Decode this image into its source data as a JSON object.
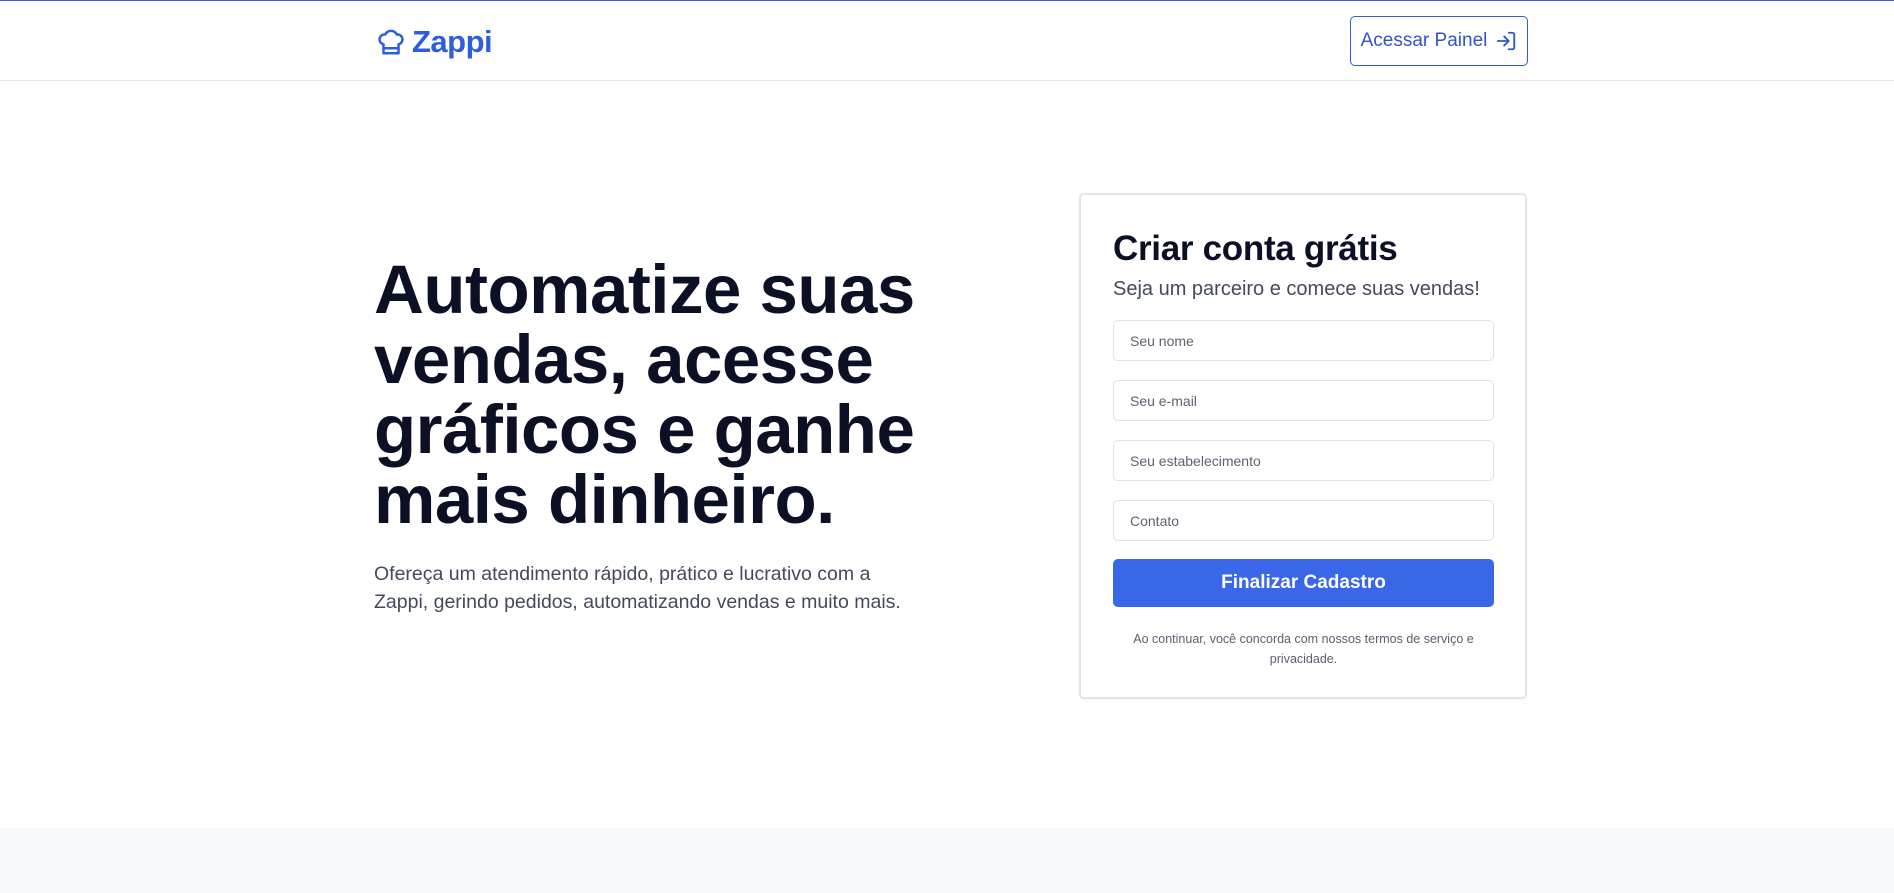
{
  "header": {
    "brand": "Zappi",
    "logo_icon": "chef-hat-icon",
    "panel_button_label": "Acessar Painel",
    "panel_button_icon": "log-in-icon"
  },
  "hero": {
    "title": "Automatize suas vendas, acesse gráficos e ganhe mais dinheiro.",
    "subtitle": "Ofereça um atendimento rápido, prático e lucrativo com a Zappi, gerindo pedidos, automatizando vendas e muito mais."
  },
  "signup": {
    "title": "Criar conta grátis",
    "subtitle": "Seja um parceiro e comece suas vendas!",
    "fields": {
      "name": {
        "placeholder": "Seu nome",
        "value": ""
      },
      "email": {
        "placeholder": "Seu e-mail",
        "value": ""
      },
      "business": {
        "placeholder": "Seu estabelecimento",
        "value": ""
      },
      "contact": {
        "placeholder": "Contato",
        "value": ""
      }
    },
    "submit_label": "Finalizar Cadastro",
    "terms": "Ao continuar, você concorda com nossos termos de serviço e privacidade."
  },
  "colors": {
    "accent": "#3a67e8",
    "brand": "#2f5de0",
    "heading": "#0c1024",
    "muted": "#434a5c"
  }
}
